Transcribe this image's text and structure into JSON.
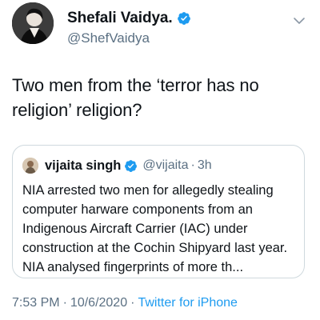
{
  "tweet": {
    "author": {
      "display_name": "Shefali Vaidya.",
      "handle": "@ShefVaidya",
      "verified": true
    },
    "text": "Two men from the ‘terror has no religion’ religion?",
    "quoted": {
      "display_name": "vijaita singh",
      "handle": "@vijaita",
      "dot": "·",
      "time": "3h",
      "verified": true,
      "text": "NIA arrested two men for allegedly stealing computer harware components from an Indigenous Aircraft Carrier (IAC) under construction at the Cochin Shipyard last year. NIA analysed fingerprints of more th..."
    },
    "footer": {
      "time": "7:53 PM",
      "sep1": "·",
      "date": "10/6/2020",
      "sep2": "·",
      "source": "Twitter for iPhone"
    }
  },
  "colors": {
    "text": "#0f1419",
    "secondary": "#5b7083",
    "link": "#1d9bf0",
    "verified": "#1d9bf0",
    "border": "#cfd9de"
  },
  "icons": {
    "verified": "verified-badge-icon",
    "more": "chevron-down-icon"
  }
}
